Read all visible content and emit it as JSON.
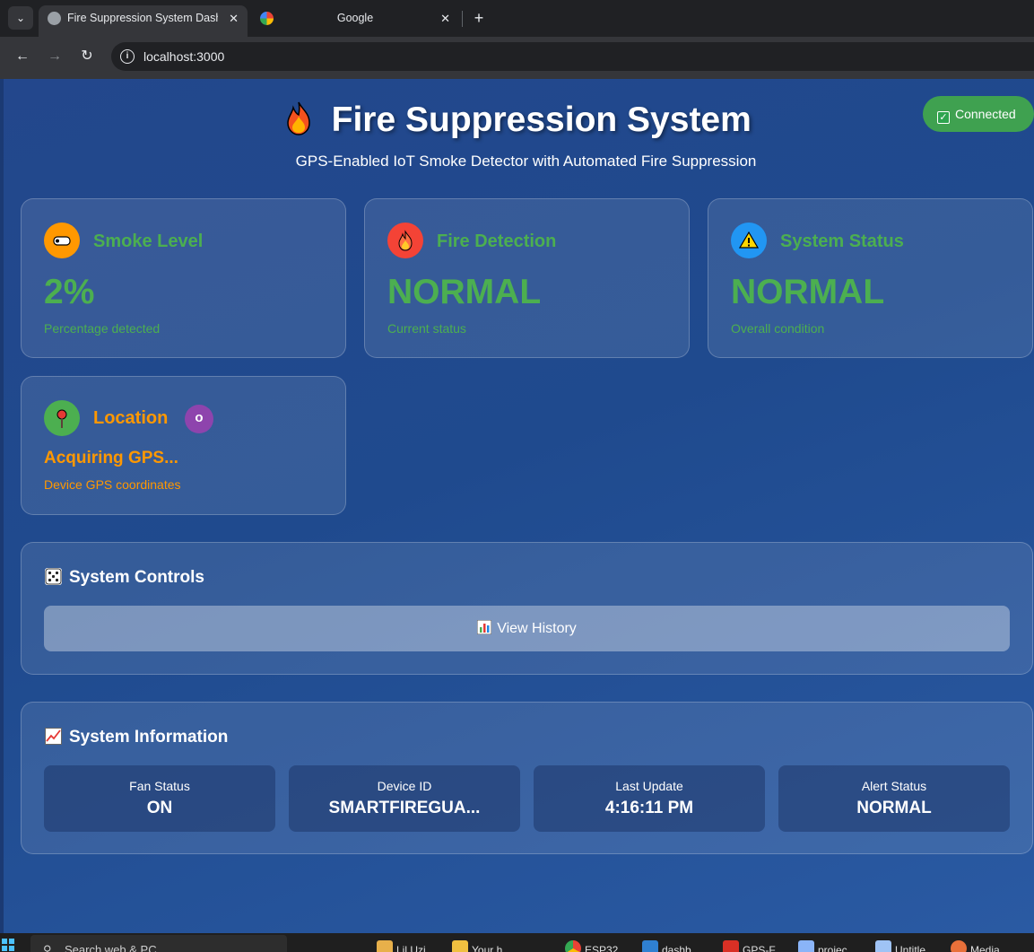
{
  "browser": {
    "tabs": [
      {
        "title": "Fire Suppression System Dashbo",
        "active": true
      },
      {
        "title": "Google",
        "active": false
      }
    ],
    "url": "localhost:3000"
  },
  "header": {
    "title": "Fire Suppression System",
    "subtitle": "GPS-Enabled IoT Smoke Detector with Automated Fire Suppression",
    "connection": "Connected"
  },
  "cards": {
    "smoke": {
      "title": "Smoke Level",
      "value": "2%",
      "caption": "Percentage detected"
    },
    "fire": {
      "title": "Fire Detection",
      "value": "NORMAL",
      "caption": "Current status"
    },
    "status": {
      "title": "System Status",
      "value": "NORMAL",
      "caption": "Overall condition"
    },
    "location": {
      "title": "Location",
      "badge": "o",
      "value": "Acquiring GPS...",
      "caption": "Device GPS coordinates"
    }
  },
  "controls": {
    "title": "System Controls",
    "history_button": "View History"
  },
  "info": {
    "title": "System Information",
    "items": [
      {
        "label": "Fan Status",
        "value": "ON"
      },
      {
        "label": "Device ID",
        "value": "SMARTFIREGUA..."
      },
      {
        "label": "Last Update",
        "value": "4:16:11 PM"
      },
      {
        "label": "Alert Status",
        "value": "NORMAL"
      }
    ]
  },
  "taskbar": {
    "search_placeholder": "Search web & PC",
    "items": [
      "Lil Uzi",
      "Your h",
      "ESP32",
      "dashb",
      "GPS-F",
      "projec",
      "Untitle",
      "Media"
    ]
  },
  "colors": {
    "accent_green": "#4caf50",
    "accent_orange": "#ff9800",
    "connected": "#3fa150"
  }
}
